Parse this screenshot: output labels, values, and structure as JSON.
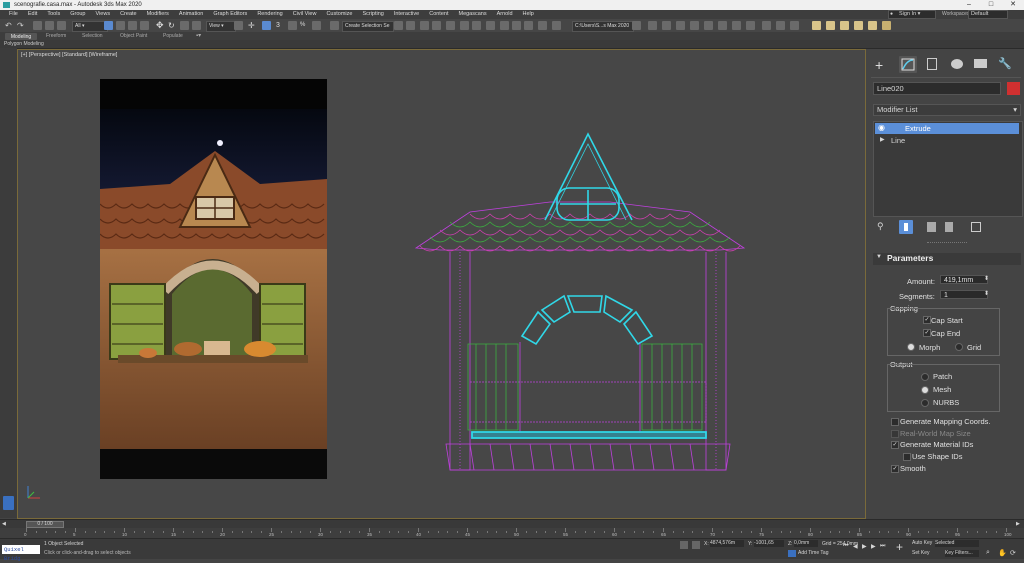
{
  "window": {
    "title": "scenografie.casa.max - Autodesk 3ds Max 2020"
  },
  "menu": [
    "File",
    "Edit",
    "Tools",
    "Group",
    "Views",
    "Create",
    "Modifiers",
    "Animation",
    "Graph Editors",
    "Rendering",
    "Civil View",
    "Customize",
    "Scripting",
    "Interactive",
    "Content",
    "Megascans",
    "Arnold",
    "Help"
  ],
  "toolbar": {
    "selection_filter": "All",
    "view_dropdown": "View",
    "named_selection": "Create Selection Se",
    "project_path": "C:\\Users\\S...s Max 2020",
    "sign_in": "Sign In",
    "workspace_label": "Workspaces:",
    "workspace_value": "Default"
  },
  "ribbon": {
    "tabs": [
      "Modeling",
      "Freeform",
      "Selection",
      "Object Paint",
      "Populate"
    ],
    "subtab": "Polygon Modeling"
  },
  "viewport": {
    "label": "[+] [Perspective] [Standard] [Wireframe]",
    "reference_image": "theatre-set-house-photo",
    "model": "house-wireframe-mesh",
    "colors": {
      "purple": "#c040e0",
      "green": "#3cb040",
      "cyan": "#30d8e8",
      "magenta": "#d040b0"
    }
  },
  "command_panel": {
    "tabs": [
      "create-icon",
      "modify-icon",
      "hierarchy-icon",
      "motion-icon",
      "display-icon",
      "utilities-icon"
    ],
    "object_name": "Line020",
    "object_color": "#d03030",
    "modifier_list_label": "Modifier List",
    "stack": [
      {
        "label": "Extrude",
        "selected": true
      },
      {
        "label": "Line",
        "selected": false
      }
    ],
    "rollout_title": "Parameters",
    "amount_label": "Amount:",
    "amount_value": "419,1mm",
    "segments_label": "Segments:",
    "segments_value": "1",
    "capping_title": "Capping",
    "cap_start": "Cap Start",
    "cap_end": "Cap End",
    "morph": "Morph",
    "grid": "Grid",
    "output_title": "Output",
    "patch": "Patch",
    "mesh": "Mesh",
    "nurbs": "NURBS",
    "gen_mapping": "Generate Mapping Coords.",
    "real_world": "Real-World Map Size",
    "gen_material": "Generate Material IDs",
    "use_shape": "Use Shape IDs",
    "smooth": "Smooth"
  },
  "timeline": {
    "frame_counter": "0 / 100",
    "ticks": [
      "0",
      "5",
      "10",
      "15",
      "20",
      "25",
      "30",
      "35",
      "40",
      "45",
      "50",
      "55",
      "60",
      "65",
      "70",
      "75",
      "80",
      "85",
      "90",
      "95",
      "100"
    ]
  },
  "status": {
    "script_label": "Quixel Bridg",
    "line1": "1 Object Selected",
    "line2": "Click or click-and-drag to select objects",
    "x_label": "X:",
    "x_value": "4874,576m",
    "y_label": "Y:",
    "y_value": "-1001,65",
    "z_label": "Z:",
    "z_value": "0,0mm",
    "grid": "Grid = 254,0mm",
    "add_time_tag": "Add Time Tag",
    "auto_key": "Auto Key",
    "set_key": "Set Key",
    "selected": "Selected",
    "key_filters": "Key Filters..."
  }
}
